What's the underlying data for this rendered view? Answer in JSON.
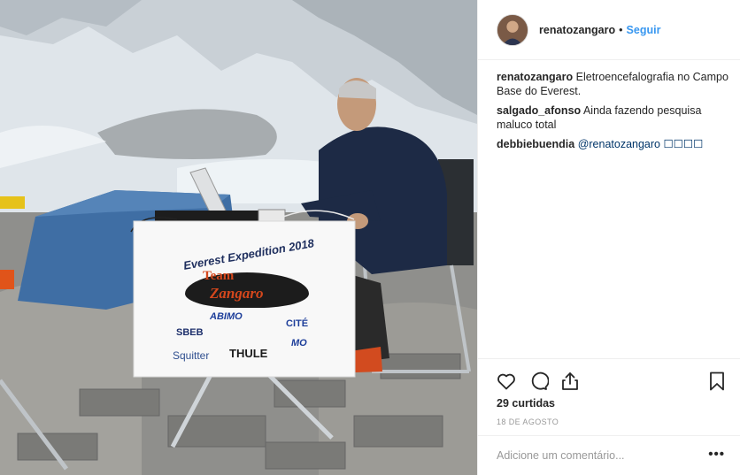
{
  "post": {
    "photo": {
      "banner": {
        "line1": "Everest Expedition 2018",
        "logo_team": "Team",
        "logo_name": "Zangaro",
        "sponsors": [
          "ABIMO",
          "SBEB",
          "CITÉ",
          "Squitter",
          "THULE",
          "MO"
        ]
      }
    },
    "header": {
      "username": "renatozangaro",
      "separator": "•",
      "follow_label": "Seguir"
    },
    "comments": [
      {
        "user": "renatozangaro",
        "text": "Eletroencefalografia no Campo Base do Everest.",
        "mention": ""
      },
      {
        "user": "salgado_afonso",
        "text": "Ainda fazendo pesquisa maluco total",
        "mention": ""
      },
      {
        "user": "debbiebuendia",
        "text": "",
        "mention": "@renatozangaro ☐☐☐☐"
      }
    ],
    "actions": {
      "like_icon": "heart-icon",
      "comment_icon": "speech-bubble-icon",
      "share_icon": "share-icon",
      "save_icon": "bookmark-icon"
    },
    "likes_text": "29 curtidas",
    "date_text": "18 DE AGOSTO",
    "add_comment": {
      "placeholder": "Adicione um comentário..."
    },
    "more_label": "•••"
  }
}
